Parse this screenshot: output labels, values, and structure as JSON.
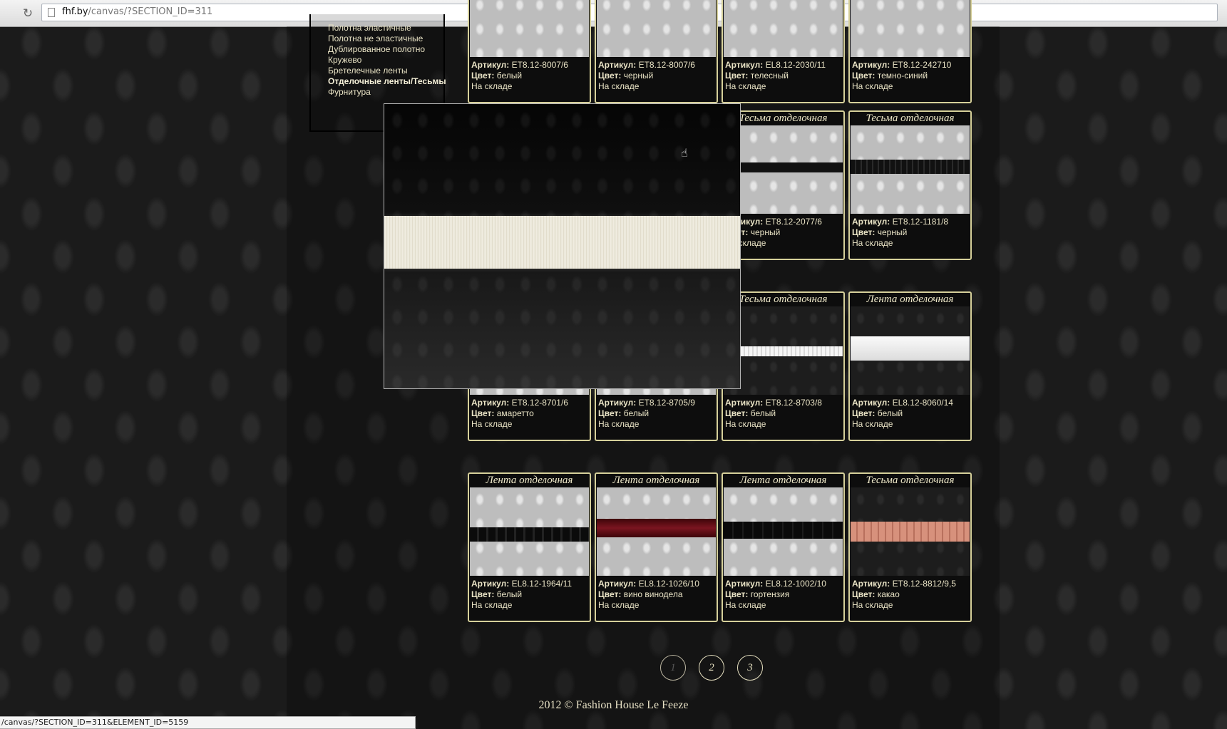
{
  "browser": {
    "url_host": "fhf.by",
    "url_path": "/canvas/?SECTION_ID=311",
    "reload_icon": "reload-icon",
    "status_url": "/canvas/?SECTION_ID=311&ELEMENT_ID=5159"
  },
  "sidebar": {
    "items": [
      {
        "label": "Полотна эластичные"
      },
      {
        "label": "Полотна не эластичные"
      },
      {
        "label": "Дублированное полотно"
      },
      {
        "label": "Кружево"
      },
      {
        "label": "Бретелечные ленты"
      },
      {
        "label": "Отделочные ленты/Тесьмы",
        "active": true
      },
      {
        "label": "Фурнитура"
      }
    ]
  },
  "labels": {
    "article": "Артикул:",
    "color": "Цвет:"
  },
  "products": [
    {
      "title": "",
      "article": "ET8.12-8007/6",
      "color": "белый",
      "stock": "На складе"
    },
    {
      "title": "",
      "article": "ET8.12-8007/6",
      "color": "черный",
      "stock": "На складе"
    },
    {
      "title": "",
      "article": "EL8.12-2030/11",
      "color": "телесный",
      "stock": "На складе"
    },
    {
      "title": "",
      "article": "ET8.12-242710",
      "color": "темно-синий",
      "stock": "На складе"
    },
    {
      "title": "",
      "article": "",
      "color": "",
      "stock": ""
    },
    {
      "title": "",
      "article": "",
      "color": "",
      "stock": ""
    },
    {
      "title": "Тесьма отделочная",
      "article": "ET8.12-2077/6",
      "color": "черный",
      "stock": "На складе"
    },
    {
      "title": "Тесьма отделочная",
      "article": "ET8.12-1181/8",
      "color": "черный",
      "stock": "На складе"
    },
    {
      "title": "",
      "article": "ET8.12-8701/6",
      "color": "амаретто",
      "stock": "На складе"
    },
    {
      "title": "",
      "article": "ET8.12-8705/9",
      "color": "белый",
      "stock": "На складе"
    },
    {
      "title": "Тесьма отделочная",
      "article": "ET8.12-8703/8",
      "color": "белый",
      "stock": "На складе"
    },
    {
      "title": "Лента отделочная",
      "article": "EL8.12-8060/14",
      "color": "белый",
      "stock": "На складе"
    },
    {
      "title": "Лента отделочная",
      "article": "EL8.12-1964/11",
      "color": "белый",
      "stock": "На складе"
    },
    {
      "title": "Лента отделочная",
      "article": "EL8.12-1026/10",
      "color": "вино винодела",
      "stock": "На складе"
    },
    {
      "title": "Лента отделочная",
      "article": "EL8.12-1002/10",
      "color": "гортензия",
      "stock": "На складе"
    },
    {
      "title": "Тесьма отделочная",
      "article": "ET8.12-8812/9,5",
      "color": "какао",
      "stock": "На складе"
    }
  ],
  "pagination": {
    "pages": [
      "1",
      "2",
      "3"
    ],
    "current": "1"
  },
  "footer": {
    "text": "2012 © Fashion House Le Feeze"
  },
  "colors": {
    "accent_border": "#d6d09a",
    "text_cream": "#eae4c6",
    "ribbon_burgundy": "#6e0f16",
    "ribbon_peach": "#d7917c"
  }
}
